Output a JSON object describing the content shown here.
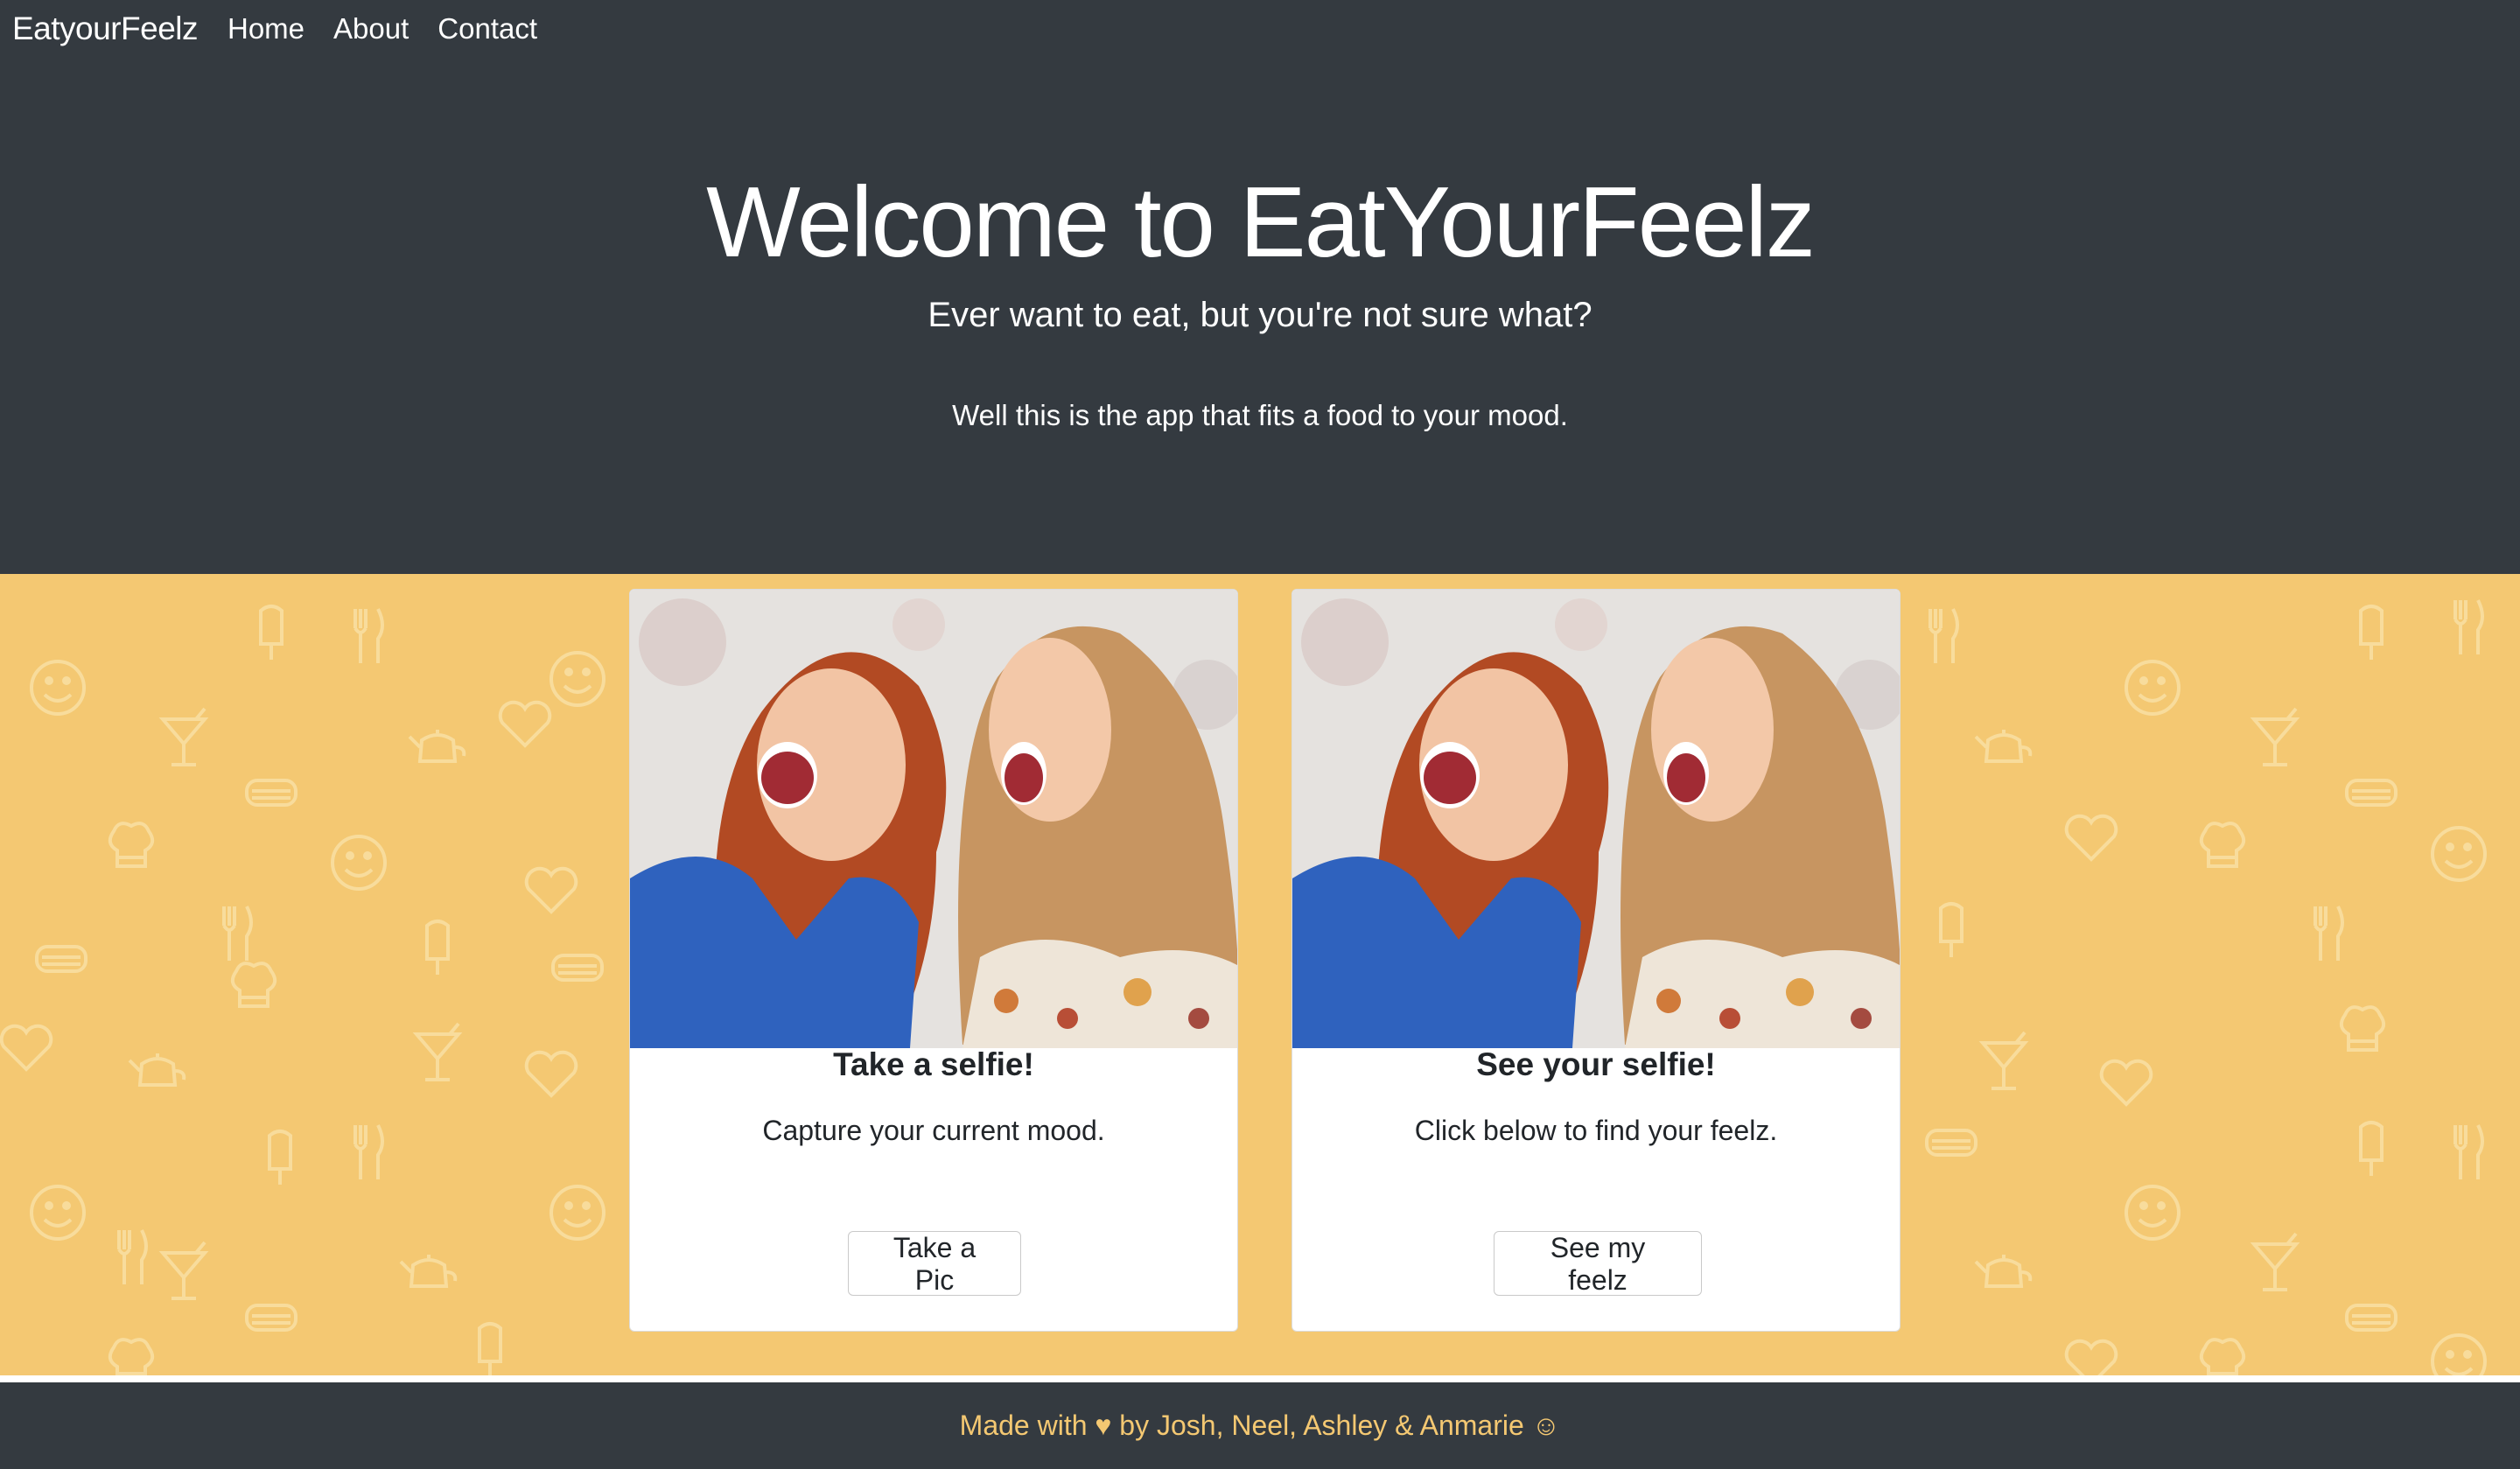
{
  "nav": {
    "brand": "EatyourFeelz",
    "links": [
      "Home",
      "About",
      "Contact"
    ]
  },
  "hero": {
    "title": "Welcome to EatYourFeelz",
    "lead": "Ever want to eat, but you're not sure what?",
    "tagline": "Well this is the app that fits a food to your mood."
  },
  "cards": [
    {
      "title": "Take a selfie!",
      "text": "Capture your current mood.",
      "button": "Take a Pic"
    },
    {
      "title": "See your selfie!",
      "text": "Click below to find your feelz.",
      "button": "See my feelz"
    }
  ],
  "footer": {
    "text": "Made with ♥ by Josh, Neel, Ashley & Anmarie ☺"
  },
  "colors": {
    "dark": "#343a40",
    "accent_yellow": "#f4c872",
    "pattern_icons": "#f8dc9c",
    "card_bg": "#ffffff"
  },
  "icons": [
    "smiley-icon",
    "fork-knife-icon",
    "heart-icon",
    "cocktail-icon",
    "teapot-icon",
    "sandwich-icon",
    "popsicle-icon",
    "chef-hat-icon"
  ]
}
